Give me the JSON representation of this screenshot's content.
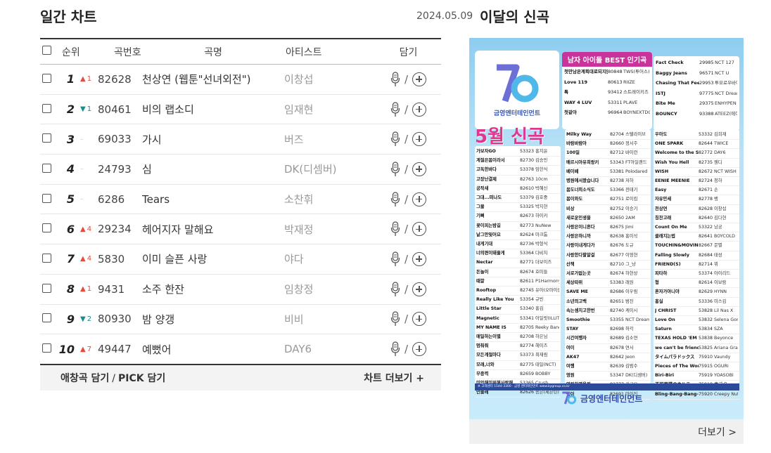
{
  "daily": {
    "title": "일간 차트",
    "headers": {
      "rank": "순위",
      "no": "곡번호",
      "title": "곡명",
      "artist": "아티스트",
      "save": "담기"
    },
    "slash": "/",
    "rows": [
      {
        "rank": "1",
        "dir": "up",
        "chg": "1",
        "no": "82628",
        "title": "천상연 (웹툰\"선녀외전\")",
        "artist": "이창섭"
      },
      {
        "rank": "2",
        "dir": "down",
        "chg": "1",
        "no": "80461",
        "title": "비의 랩소디",
        "artist": "임재현"
      },
      {
        "rank": "3",
        "dir": "same",
        "chg": "–",
        "no": "69033",
        "title": "가시",
        "artist": "버즈"
      },
      {
        "rank": "4",
        "dir": "same",
        "chg": "–",
        "no": "24793",
        "title": "심",
        "artist": "DK(디셈버)"
      },
      {
        "rank": "5",
        "dir": "same",
        "chg": "–",
        "no": "6286",
        "title": "Tears",
        "artist": "소찬휘"
      },
      {
        "rank": "6",
        "dir": "up",
        "chg": "4",
        "no": "29234",
        "title": "헤어지자 말해요",
        "artist": "박재정"
      },
      {
        "rank": "7",
        "dir": "up",
        "chg": "4",
        "no": "5830",
        "title": "이미 슬픈 사랑",
        "artist": "야다"
      },
      {
        "rank": "8",
        "dir": "up",
        "chg": "1",
        "no": "9431",
        "title": "소주 한잔",
        "artist": "임창정"
      },
      {
        "rank": "9",
        "dir": "down",
        "chg": "2",
        "no": "80930",
        "title": "밤 양갱",
        "artist": "비비"
      },
      {
        "rank": "10",
        "dir": "up",
        "chg": "7",
        "no": "49447",
        "title": "예뻤어",
        "artist": "DAY6"
      }
    ],
    "footer": {
      "left1": "애창곡 담기",
      "sep": "/",
      "left2": "PICK 담기",
      "right": "차트 더보기 +"
    }
  },
  "newsongs": {
    "date": "2024.05.09",
    "title": "이달의 신곡",
    "more": "더보기 >",
    "poster": {
      "company": "금영엔터테인먼트",
      "best_title": "남자 아이돌 BEST 인기곡",
      "may_title": "5월 신곡",
      "best_left": [
        {
          "t": "첫만남은계획대로되지않아",
          "n": "80848",
          "a": "TWS(투어스)"
        },
        {
          "t": "Love 119",
          "n": "80613",
          "a": "RIIZE"
        },
        {
          "t": "톡",
          "n": "93412",
          "a": "스트레이키즈"
        },
        {
          "t": "WAY 4 LUV",
          "n": "53311",
          "a": "PLAVE"
        },
        {
          "t": "첫같아",
          "n": "96964",
          "a": "BOYNEXTDOOR"
        }
      ],
      "best_right": [
        {
          "t": "Fact Check",
          "n": "29985",
          "a": "NCT 127"
        },
        {
          "t": "Baggy Jeans",
          "n": "96571",
          "a": "NCT U"
        },
        {
          "t": "Chasing That Feeling",
          "n": "29953",
          "a": "투모로우바이투게더"
        },
        {
          "t": "ISTJ",
          "n": "97775",
          "a": "NCT Dream"
        },
        {
          "t": "Bite Me",
          "n": "29375",
          "a": "ENHYPEN"
        },
        {
          "t": "BOUNCY",
          "n": "93388",
          "a": "ATEEZ(에이티즈)"
        }
      ],
      "list1": [
        {
          "t": "가보자GO",
          "n": "53323",
          "a": "홍지윤"
        },
        {
          "t": "계절은봄이라서",
          "n": "82730",
          "a": "김승민"
        },
        {
          "t": "고독한바다",
          "n": "53378",
          "a": "임한식"
        },
        {
          "t": "고장난결제",
          "n": "82763",
          "a": "10cm"
        },
        {
          "t": "공작새",
          "n": "82610",
          "a": "박혜신"
        },
        {
          "t": "그대...떠나도",
          "n": "53379",
          "a": "김호중"
        },
        {
          "t": "그물",
          "n": "53325",
          "a": "박지현"
        },
        {
          "t": "기뻐",
          "n": "82673",
          "a": "하이키"
        },
        {
          "t": "꽃이피는밤길",
          "n": "82773",
          "a": "NuNew"
        },
        {
          "t": "날그만잊어요",
          "n": "82624",
          "a": "마크툽"
        },
        {
          "t": "내게기대",
          "n": "82736",
          "a": "박형식"
        },
        {
          "t": "너의편이돼줄게",
          "n": "53364",
          "a": "다비치"
        },
        {
          "t": "Nectar",
          "n": "82771",
          "a": "더보이즈"
        },
        {
          "t": "돈놀이",
          "n": "82674",
          "a": "호미들"
        },
        {
          "t": "때깔",
          "n": "82611",
          "a": "P1Harmony"
        },
        {
          "t": "Rooftop",
          "n": "82745",
          "a": "유아(오마이걸)"
        },
        {
          "t": "Really Like You",
          "n": "53354",
          "a": "규빈"
        },
        {
          "t": "Little Star",
          "n": "53340",
          "a": "홍김"
        },
        {
          "t": "Magnetic",
          "n": "53341",
          "a": "아일릿(ILLIT)"
        },
        {
          "t": "MY NAME IS",
          "n": "82705",
          "a": "Reeky Bang"
        },
        {
          "t": "매일하는이별",
          "n": "82708",
          "a": "하은님"
        },
        {
          "t": "멈춰줘",
          "n": "82774",
          "a": "헤이즈"
        },
        {
          "t": "모든계절마다",
          "n": "53373",
          "a": "최재림"
        },
        {
          "t": "모래,너와",
          "n": "82775",
          "a": "태일(NCT)"
        },
        {
          "t": "무중력",
          "n": "82659",
          "a": "BOBBY"
        },
        {
          "t": "미안해미워해사랑해",
          "n": "53365",
          "a": "Crush"
        },
        {
          "t": "민들레",
          "n": "82626",
          "a": "송은(세븐틴)"
        }
      ],
      "list2": [
        {
          "t": "Milky Way",
          "n": "82704",
          "a": "스텔라이브"
        },
        {
          "t": "바람바람아",
          "n": "82660",
          "a": "정서주"
        },
        {
          "t": "100일",
          "n": "82712",
          "a": "바이런"
        },
        {
          "t": "배르시아유희랑키",
          "n": "53343",
          "a": "FT아일랜드"
        },
        {
          "t": "베이베",
          "n": "53381",
          "a": "Polodared"
        },
        {
          "t": "병원에서봤습니다",
          "n": "82738",
          "a": "저하"
        },
        {
          "t": "봄도너의소식도",
          "n": "53366",
          "a": "전태기"
        },
        {
          "t": "봄이와도",
          "n": "82751",
          "a": "로이킴"
        },
        {
          "t": "비상",
          "n": "82752",
          "a": "이승기"
        },
        {
          "t": "새로운인생을",
          "n": "82650",
          "a": "2AM"
        },
        {
          "t": "사랑은이니흔다",
          "n": "82675",
          "a": "Jimi"
        },
        {
          "t": "사랑은하니까",
          "n": "82638",
          "a": "홍이삭"
        },
        {
          "t": "사랑이내게다가",
          "n": "82676",
          "a": "도규"
        },
        {
          "t": "사랑한다할말걸",
          "n": "82677",
          "a": "이영현"
        },
        {
          "t": "산책",
          "n": "82710",
          "a": "그_냥"
        },
        {
          "t": "서로가없는곳",
          "n": "82674",
          "a": "하현상"
        },
        {
          "t": "세상따위",
          "n": "53383",
          "a": "래원"
        },
        {
          "t": "SAVE ME",
          "n": "82686",
          "a": "이우림"
        },
        {
          "t": "소년의고백",
          "n": "82651",
          "a": "범진"
        },
        {
          "t": "속는셈치고한번",
          "n": "82740",
          "a": "케이시"
        },
        {
          "t": "Smoothie",
          "n": "53355",
          "a": "NCT Dream"
        },
        {
          "t": "STAY",
          "n": "82698",
          "a": "허각"
        },
        {
          "t": "시간여행자",
          "n": "82689",
          "a": "김소연"
        },
        {
          "t": "여이",
          "n": "82678",
          "a": "연서"
        },
        {
          "t": "AK47",
          "n": "82642",
          "a": "Jeon"
        },
        {
          "t": "여행",
          "n": "82639",
          "a": "김범수"
        },
        {
          "t": "영원",
          "n": "53347",
          "a": "DK(디셈버)"
        },
        {
          "t": "영원하였음원",
          "n": "82777",
          "a": "김구윤"
        },
        {
          "t": "용이",
          "n": "82691",
          "a": "마이진"
        }
      ],
      "list3": [
        {
          "t": "우아도",
          "n": "53332",
          "a": "김희재"
        },
        {
          "t": "ONE SPARK",
          "n": "82644",
          "a": "TWICE"
        },
        {
          "t": "Welcome to the Show",
          "n": "82772",
          "a": "DAY6"
        },
        {
          "t": "Wish You Hell",
          "n": "82735",
          "a": "웬디"
        },
        {
          "t": "WISH",
          "n": "82672",
          "a": "NCT WISH"
        },
        {
          "t": "EENIE MEENIE",
          "n": "82724",
          "a": "청하"
        },
        {
          "t": "Easy",
          "n": "82671",
          "a": "손"
        },
        {
          "t": "자유만세",
          "n": "82778",
          "a": "뱅"
        },
        {
          "t": "천상연",
          "n": "82628",
          "a": "이창섭"
        },
        {
          "t": "칭찬고래",
          "n": "82640",
          "a": "김다현"
        },
        {
          "t": "Count On Me",
          "n": "53322",
          "a": "남궁"
        },
        {
          "t": "클래지는법",
          "n": "82641",
          "a": "BOYCOLD"
        },
        {
          "t": "TOUCHIN&MOVIN",
          "n": "82667",
          "a": "문별"
        },
        {
          "t": "Falling Slowly",
          "n": "82684",
          "a": "태성"
        },
        {
          "t": "FRIEND(S)",
          "n": "82714",
          "a": "뷔"
        },
        {
          "t": "피타하",
          "n": "53374",
          "a": "아이리드"
        },
        {
          "t": "형",
          "n": "82614",
          "a": "이보람"
        },
        {
          "t": "혼자가아니야",
          "n": "82629",
          "a": "HYNN"
        },
        {
          "t": "홍실",
          "n": "53336",
          "a": "미스김"
        },
        {
          "t": "J CHRIST",
          "n": "53828",
          "a": "Lil Nas X"
        },
        {
          "t": "Love On",
          "n": "53832",
          "a": "Selena Gomez"
        },
        {
          "t": "Saturn",
          "n": "53834",
          "a": "SZA"
        },
        {
          "t": "TEXAS HOLD 'EM",
          "n": "53838",
          "a": "Beyonce"
        },
        {
          "t": "we can't be friends",
          "n": "53825",
          "a": "Ariana Grande"
        },
        {
          "t": "タイムパラドックス",
          "n": "75910",
          "a": "Vaundy"
        },
        {
          "t": "Pieces of The World",
          "n": "75915",
          "a": "OGURI"
        },
        {
          "t": "Biri-Biri",
          "n": "75919",
          "a": "YOASOBI"
        },
        {
          "t": "不可思議のカルテ",
          "n": "75918",
          "a": "青ブタ"
        },
        {
          "t": "Bling-Bang-Bang-Born",
          "n": "75920",
          "a": "Creepy Nuts"
        }
      ],
      "note": "※ 고객센터 1544-3300 · 금영 엔터테인먼트 www.kygroup.co.kr"
    }
  }
}
